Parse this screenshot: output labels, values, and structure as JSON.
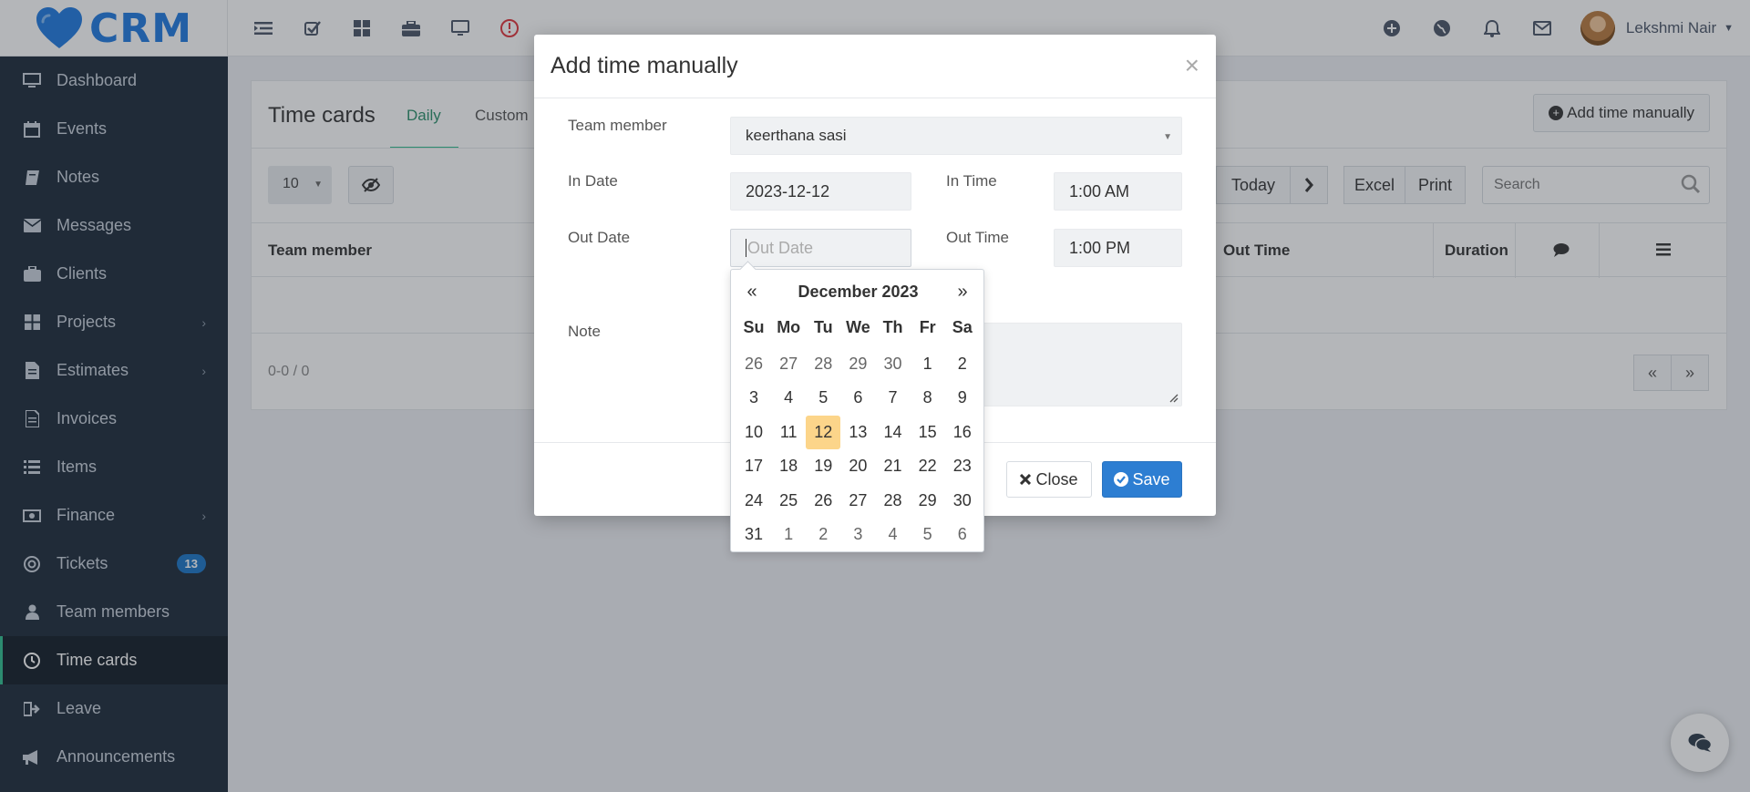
{
  "app": {
    "logo_text": "CRM"
  },
  "user": {
    "name": "Lekshmi Nair"
  },
  "sidebar": {
    "items": [
      {
        "label": "Dashboard"
      },
      {
        "label": "Events"
      },
      {
        "label": "Notes"
      },
      {
        "label": "Messages"
      },
      {
        "label": "Clients"
      },
      {
        "label": "Projects"
      },
      {
        "label": "Estimates"
      },
      {
        "label": "Invoices"
      },
      {
        "label": "Items"
      },
      {
        "label": "Finance"
      },
      {
        "label": "Tickets",
        "badge": "13"
      },
      {
        "label": "Team members"
      },
      {
        "label": "Time cards"
      },
      {
        "label": "Leave"
      },
      {
        "label": "Announcements"
      }
    ]
  },
  "page": {
    "title": "Time cards",
    "tabs": [
      "Daily",
      "Custom"
    ],
    "add_button": "Add time manually",
    "page_size": "10",
    "today_button": "Today",
    "excel_button": "Excel",
    "print_button": "Print",
    "search_placeholder": "Search",
    "columns": {
      "team_member": "Team member",
      "out_time": "Out Time",
      "duration": "Duration"
    },
    "pager_info": "0-0 / 0",
    "pager_prev": "«",
    "pager_next": "»"
  },
  "modal": {
    "title": "Add time manually",
    "close_x": "×",
    "labels": {
      "team_member": "Team member",
      "in_date": "In Date",
      "in_time": "In Time",
      "out_date": "Out Date",
      "out_time": "Out Time",
      "note": "Note"
    },
    "values": {
      "team_member": "keerthana sasi",
      "in_date": "2023-12-12",
      "in_time": "1:00 AM",
      "out_date_placeholder": "Out Date",
      "out_time": "1:00 PM"
    },
    "close_button": "Close",
    "save_button": "Save"
  },
  "datepicker": {
    "prev": "«",
    "next": "»",
    "month_label": "December 2023",
    "dow": [
      "Su",
      "Mo",
      "Tu",
      "We",
      "Th",
      "Fr",
      "Sa"
    ],
    "weeks": [
      [
        "26",
        "27",
        "28",
        "29",
        "30",
        "1",
        "2"
      ],
      [
        "3",
        "4",
        "5",
        "6",
        "7",
        "8",
        "9"
      ],
      [
        "10",
        "11",
        "12",
        "13",
        "14",
        "15",
        "16"
      ],
      [
        "17",
        "18",
        "19",
        "20",
        "21",
        "22",
        "23"
      ],
      [
        "24",
        "25",
        "26",
        "27",
        "28",
        "29",
        "30"
      ],
      [
        "31",
        "1",
        "2",
        "3",
        "4",
        "5",
        "6"
      ]
    ],
    "highlighted_day": "12"
  },
  "colors": {
    "sidebar_bg": "#1c2a3a",
    "accent_green": "#2fbf8f",
    "primary_blue": "#2d7ed2",
    "today_highlight": "#fcd58a"
  }
}
